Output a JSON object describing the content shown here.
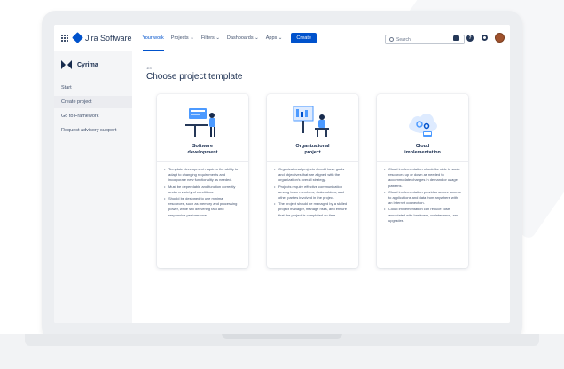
{
  "app": {
    "name": "Jira Software"
  },
  "nav": {
    "items": [
      {
        "label": "Your work"
      },
      {
        "label": "Projects ⌄"
      },
      {
        "label": "Filters ⌄"
      },
      {
        "label": "Dashboards ⌄"
      },
      {
        "label": "Apps ⌄"
      }
    ],
    "create_label": "Create",
    "search_placeholder": "Search"
  },
  "sidebar": {
    "org_name": "Cyrima",
    "items": [
      {
        "label": "Start"
      },
      {
        "label": "Create project"
      },
      {
        "label": "Go to Framework"
      },
      {
        "label": "Request advisory support"
      }
    ]
  },
  "main": {
    "step": "1/3",
    "title": "Choose project template",
    "cards": [
      {
        "title": "Software development",
        "bullets": [
          "Template development requires the ability to adapt to changing requirements and incorporate new functionality as needed.",
          "Must be dependable and function correctly under a variety of conditions.",
          "Should be designed to use minimal resources, such as memory and processing power, while still delivering fast and responsive performance."
        ]
      },
      {
        "title": "Organizational project",
        "bullets": [
          "Organizational projects should have goals and objectives that are aligned with the organization's overall strategy.",
          "Projects require effective communication among team members, stakeholders, and other parties involved in the project.",
          "The project should be managed by a skilled project manager, manage risks, and ensure that the project is completed on time"
        ]
      },
      {
        "title": "Cloud implementation",
        "bullets": [
          "Cloud implementation should be able to scale resources up or down as needed to accommodate changes in demand or usage patterns.",
          "Cloud implementation provides secure access to applications and data from anywhere with an Internet connection.",
          "Cloud implementation can reduce costs associated with hardware, maintenance, and upgrades."
        ]
      }
    ]
  },
  "colors": {
    "brand": "#0052cc",
    "sidebar_bg": "#f4f5f7",
    "text": "#172b4d"
  },
  "icons": [
    "app-switcher-icon",
    "jira-logo-icon",
    "search-icon",
    "notifications-icon",
    "help-icon",
    "settings-icon",
    "avatar"
  ]
}
